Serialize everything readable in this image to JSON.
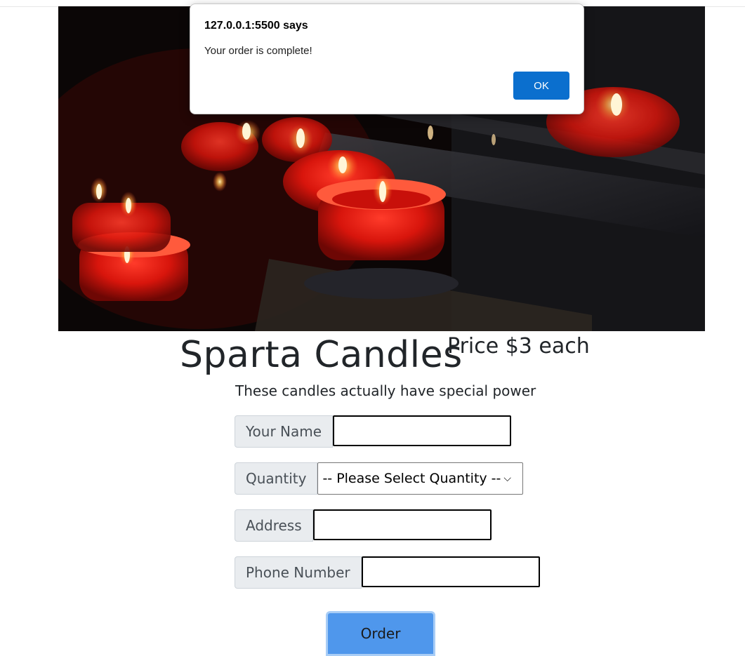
{
  "dialog": {
    "origin": "127.0.0.1:5500 says",
    "message": "Your order is complete!",
    "ok_label": "OK"
  },
  "hero": {
    "image_subject": "red-tealight-candles-photo"
  },
  "header": {
    "title": "Sparta Candles",
    "price": "Price $3 each",
    "tagline": "These candles actually have special power"
  },
  "form": {
    "name": {
      "label": "Your Name",
      "value": ""
    },
    "quantity": {
      "label": "Quantity",
      "selected": "-- Please Select Quantity --"
    },
    "address": {
      "label": "Address",
      "value": ""
    },
    "phone": {
      "label": "Phone Number",
      "value": ""
    },
    "submit_label": "Order"
  },
  "colors": {
    "accent_button": "#4f97ec",
    "dialog_button": "#0b6fce",
    "addon_background": "#e9ecef"
  }
}
